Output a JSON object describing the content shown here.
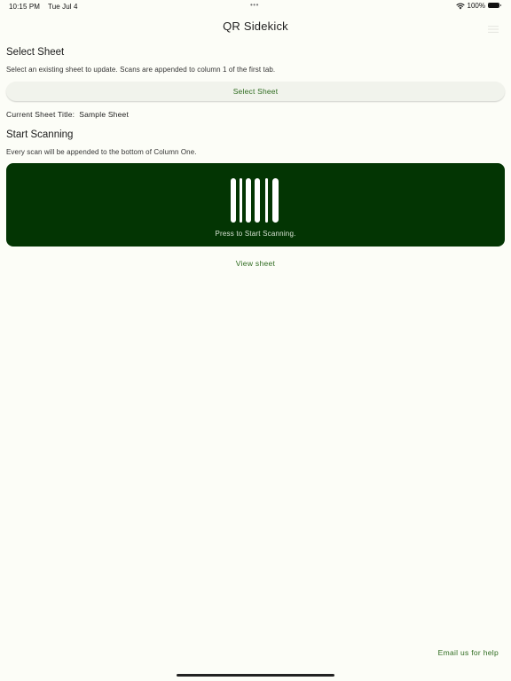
{
  "status_bar": {
    "time": "10:15 PM",
    "date": "Tue Jul 4",
    "battery": "100%",
    "multitasking_dots": "•••"
  },
  "app": {
    "title": "QR Sidekick"
  },
  "select_section": {
    "title": "Select Sheet",
    "description": "Select an existing sheet to update. Scans are appended to column 1 of the first tab.",
    "button_label": "Select Sheet",
    "current_label": "Current Sheet Title:",
    "current_value": "Sample Sheet"
  },
  "scan_section": {
    "title": "Start Scanning",
    "description": "Every scan will be appended to the bottom of Column One.",
    "button_label": "Press to Start Scanning."
  },
  "links": {
    "view_sheet": "View sheet",
    "email_help": "Email us for help"
  },
  "colors": {
    "background": "#fcfdf7",
    "accent": "#2e6b1f",
    "scan_button": "#033503"
  },
  "icons": {
    "scan": "barcode-icon",
    "wifi": "wifi-icon",
    "battery": "battery-icon",
    "menu": "menu-icon"
  }
}
